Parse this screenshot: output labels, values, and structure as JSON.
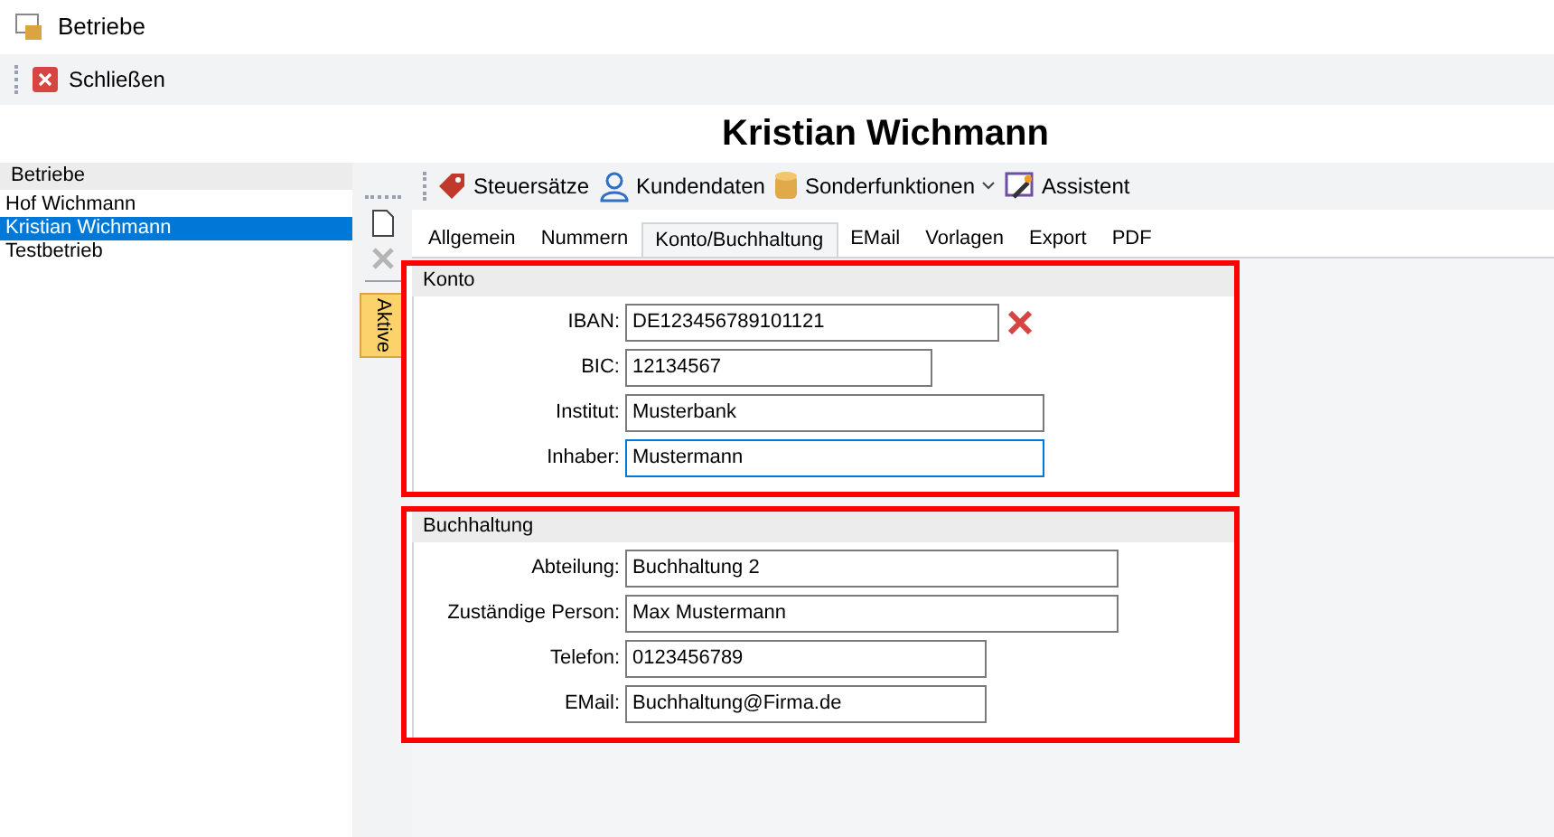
{
  "window": {
    "title": "Betriebe"
  },
  "toolbar": {
    "buttons": [
      {
        "label": "Schließen"
      }
    ]
  },
  "header": {
    "title": "Kristian Wichmann"
  },
  "sidebar": {
    "heading": "Betriebe",
    "items": [
      {
        "label": "Hof Wichmann",
        "selected": false
      },
      {
        "label": "Kristian Wichmann",
        "selected": true
      },
      {
        "label": "Testbetrieb",
        "selected": false
      }
    ]
  },
  "side_tabs": [
    {
      "label": "Aktive",
      "selected": true
    }
  ],
  "content_toolbar": [
    {
      "label": "Steuersätze",
      "kind": "tag",
      "dropdown": false
    },
    {
      "label": "Kundendaten",
      "kind": "person",
      "dropdown": false
    },
    {
      "label": "Sonderfunktionen",
      "kind": "database",
      "dropdown": true
    },
    {
      "label": "Assistent",
      "kind": "wand",
      "dropdown": false
    }
  ],
  "tabs": [
    {
      "label": "Allgemein",
      "selected": false
    },
    {
      "label": "Nummern",
      "selected": false
    },
    {
      "label": "Konto/Buchhaltung",
      "selected": true
    },
    {
      "label": "EMail",
      "selected": false
    },
    {
      "label": "Vorlagen",
      "selected": false
    },
    {
      "label": "Export",
      "selected": false
    },
    {
      "label": "PDF",
      "selected": false
    }
  ],
  "sections": [
    {
      "title": "Konto",
      "fields": [
        {
          "label": "IBAN:",
          "value": "DE123456789101121",
          "focused": false,
          "clearable": true
        },
        {
          "label": "BIC:",
          "value": "12134567",
          "focused": false,
          "clearable": false
        },
        {
          "label": "Institut:",
          "value": "Musterbank",
          "focused": false,
          "clearable": false
        },
        {
          "label": "Inhaber:",
          "value": "Mustermann",
          "focused": true,
          "clearable": false
        }
      ]
    },
    {
      "title": "Buchhaltung",
      "fields": [
        {
          "label": "Abteilung:",
          "value": "Buchhaltung 2",
          "focused": false,
          "clearable": false
        },
        {
          "label": "Zuständige Person:",
          "value": "Max Mustermann",
          "focused": false,
          "clearable": false
        },
        {
          "label": "Telefon:",
          "value": "0123456789",
          "focused": false,
          "clearable": false
        },
        {
          "label": "EMail:",
          "value": "Buchhaltung@Firma.de",
          "focused": false,
          "clearable": false
        }
      ]
    }
  ]
}
